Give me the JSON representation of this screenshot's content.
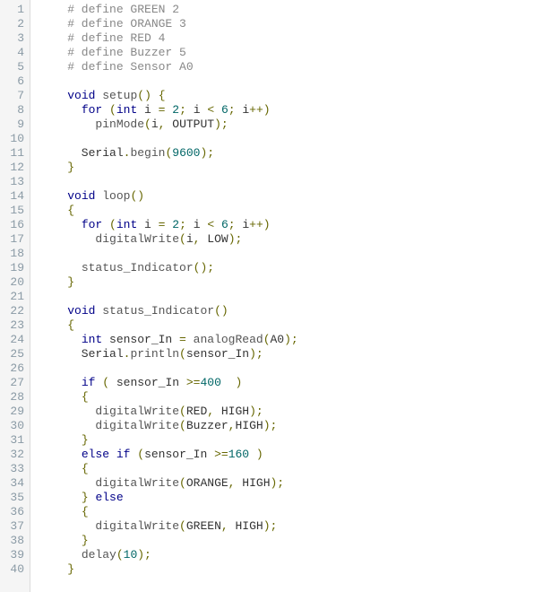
{
  "editor": {
    "lines": [
      {
        "n": 1,
        "tokens": [
          [
            "pp",
            "    # define GREEN 2"
          ]
        ]
      },
      {
        "n": 2,
        "tokens": [
          [
            "pp",
            "    # define ORANGE 3"
          ]
        ]
      },
      {
        "n": 3,
        "tokens": [
          [
            "pp",
            "    # define RED 4"
          ]
        ]
      },
      {
        "n": 4,
        "tokens": [
          [
            "pp",
            "    # define Buzzer 5"
          ]
        ]
      },
      {
        "n": 5,
        "tokens": [
          [
            "pp",
            "    # define Sensor A0"
          ]
        ]
      },
      {
        "n": 6,
        "tokens": [
          [
            "id",
            ""
          ]
        ]
      },
      {
        "n": 7,
        "tokens": [
          [
            "id",
            "    "
          ],
          [
            "kw",
            "void"
          ],
          [
            "id",
            " "
          ],
          [
            "fn",
            "setup"
          ],
          [
            "op",
            "()"
          ],
          [
            "id",
            " "
          ],
          [
            "op",
            "{"
          ]
        ]
      },
      {
        "n": 8,
        "tokens": [
          [
            "id",
            "      "
          ],
          [
            "kw",
            "for"
          ],
          [
            "id",
            " "
          ],
          [
            "op",
            "("
          ],
          [
            "kw",
            "int"
          ],
          [
            "id",
            " i "
          ],
          [
            "op",
            "="
          ],
          [
            "id",
            " "
          ],
          [
            "num",
            "2"
          ],
          [
            "op",
            ";"
          ],
          [
            "id",
            " i "
          ],
          [
            "op",
            "<"
          ],
          [
            "id",
            " "
          ],
          [
            "num",
            "6"
          ],
          [
            "op",
            ";"
          ],
          [
            "id",
            " i"
          ],
          [
            "op",
            "++)"
          ]
        ]
      },
      {
        "n": 9,
        "tokens": [
          [
            "id",
            "        "
          ],
          [
            "fn",
            "pinMode"
          ],
          [
            "op",
            "("
          ],
          [
            "id",
            "i"
          ],
          [
            "op",
            ","
          ],
          [
            "id",
            " OUTPUT"
          ],
          [
            "op",
            ");"
          ]
        ]
      },
      {
        "n": 10,
        "tokens": [
          [
            "id",
            ""
          ]
        ]
      },
      {
        "n": 11,
        "tokens": [
          [
            "id",
            "      Serial"
          ],
          [
            "op",
            "."
          ],
          [
            "fn",
            "begin"
          ],
          [
            "op",
            "("
          ],
          [
            "num",
            "9600"
          ],
          [
            "op",
            ");"
          ]
        ]
      },
      {
        "n": 12,
        "tokens": [
          [
            "id",
            "    "
          ],
          [
            "op",
            "}"
          ]
        ]
      },
      {
        "n": 13,
        "tokens": [
          [
            "id",
            ""
          ]
        ]
      },
      {
        "n": 14,
        "tokens": [
          [
            "id",
            "    "
          ],
          [
            "kw",
            "void"
          ],
          [
            "id",
            " "
          ],
          [
            "fn",
            "loop"
          ],
          [
            "op",
            "()"
          ]
        ]
      },
      {
        "n": 15,
        "tokens": [
          [
            "id",
            "    "
          ],
          [
            "op",
            "{"
          ]
        ]
      },
      {
        "n": 16,
        "tokens": [
          [
            "id",
            "      "
          ],
          [
            "kw",
            "for"
          ],
          [
            "id",
            " "
          ],
          [
            "op",
            "("
          ],
          [
            "kw",
            "int"
          ],
          [
            "id",
            " i "
          ],
          [
            "op",
            "="
          ],
          [
            "id",
            " "
          ],
          [
            "num",
            "2"
          ],
          [
            "op",
            ";"
          ],
          [
            "id",
            " i "
          ],
          [
            "op",
            "<"
          ],
          [
            "id",
            " "
          ],
          [
            "num",
            "6"
          ],
          [
            "op",
            ";"
          ],
          [
            "id",
            " i"
          ],
          [
            "op",
            "++)"
          ]
        ]
      },
      {
        "n": 17,
        "tokens": [
          [
            "id",
            "        "
          ],
          [
            "fn",
            "digitalWrite"
          ],
          [
            "op",
            "("
          ],
          [
            "id",
            "i"
          ],
          [
            "op",
            ","
          ],
          [
            "id",
            " LOW"
          ],
          [
            "op",
            ");"
          ]
        ]
      },
      {
        "n": 18,
        "tokens": [
          [
            "id",
            ""
          ]
        ]
      },
      {
        "n": 19,
        "tokens": [
          [
            "id",
            "      "
          ],
          [
            "fn",
            "status_Indicator"
          ],
          [
            "op",
            "();"
          ]
        ]
      },
      {
        "n": 20,
        "tokens": [
          [
            "id",
            "    "
          ],
          [
            "op",
            "}"
          ]
        ]
      },
      {
        "n": 21,
        "tokens": [
          [
            "id",
            ""
          ]
        ]
      },
      {
        "n": 22,
        "tokens": [
          [
            "id",
            "    "
          ],
          [
            "kw",
            "void"
          ],
          [
            "id",
            " "
          ],
          [
            "fn",
            "status_Indicator"
          ],
          [
            "op",
            "()"
          ]
        ]
      },
      {
        "n": 23,
        "tokens": [
          [
            "id",
            "    "
          ],
          [
            "op",
            "{"
          ]
        ]
      },
      {
        "n": 24,
        "tokens": [
          [
            "id",
            "      "
          ],
          [
            "kw",
            "int"
          ],
          [
            "id",
            " sensor_In "
          ],
          [
            "op",
            "="
          ],
          [
            "id",
            " "
          ],
          [
            "fn",
            "analogRead"
          ],
          [
            "op",
            "("
          ],
          [
            "id",
            "A0"
          ],
          [
            "op",
            ");"
          ]
        ]
      },
      {
        "n": 25,
        "tokens": [
          [
            "id",
            "      Serial"
          ],
          [
            "op",
            "."
          ],
          [
            "fn",
            "println"
          ],
          [
            "op",
            "("
          ],
          [
            "id",
            "sensor_In"
          ],
          [
            "op",
            ");"
          ]
        ]
      },
      {
        "n": 26,
        "tokens": [
          [
            "id",
            ""
          ]
        ]
      },
      {
        "n": 27,
        "tokens": [
          [
            "id",
            "      "
          ],
          [
            "kw",
            "if"
          ],
          [
            "id",
            " "
          ],
          [
            "op",
            "("
          ],
          [
            "id",
            " sensor_In "
          ],
          [
            "op",
            ">="
          ],
          [
            "num",
            "400"
          ],
          [
            "id",
            "  "
          ],
          [
            "op",
            ")"
          ]
        ]
      },
      {
        "n": 28,
        "tokens": [
          [
            "id",
            "      "
          ],
          [
            "op",
            "{"
          ]
        ]
      },
      {
        "n": 29,
        "tokens": [
          [
            "id",
            "        "
          ],
          [
            "fn",
            "digitalWrite"
          ],
          [
            "op",
            "("
          ],
          [
            "id",
            "RED"
          ],
          [
            "op",
            ","
          ],
          [
            "id",
            " HIGH"
          ],
          [
            "op",
            ");"
          ]
        ]
      },
      {
        "n": 30,
        "tokens": [
          [
            "id",
            "        "
          ],
          [
            "fn",
            "digitalWrite"
          ],
          [
            "op",
            "("
          ],
          [
            "id",
            "Buzzer"
          ],
          [
            "op",
            ","
          ],
          [
            "id",
            "HIGH"
          ],
          [
            "op",
            ");"
          ]
        ]
      },
      {
        "n": 31,
        "tokens": [
          [
            "id",
            "      "
          ],
          [
            "op",
            "}"
          ]
        ]
      },
      {
        "n": 32,
        "tokens": [
          [
            "id",
            "      "
          ],
          [
            "kw",
            "else"
          ],
          [
            "id",
            " "
          ],
          [
            "kw",
            "if"
          ],
          [
            "id",
            " "
          ],
          [
            "op",
            "("
          ],
          [
            "id",
            "sensor_In "
          ],
          [
            "op",
            ">="
          ],
          [
            "num",
            "160"
          ],
          [
            "id",
            " "
          ],
          [
            "op",
            ")"
          ]
        ]
      },
      {
        "n": 33,
        "tokens": [
          [
            "id",
            "      "
          ],
          [
            "op",
            "{"
          ]
        ]
      },
      {
        "n": 34,
        "tokens": [
          [
            "id",
            "        "
          ],
          [
            "fn",
            "digitalWrite"
          ],
          [
            "op",
            "("
          ],
          [
            "id",
            "ORANGE"
          ],
          [
            "op",
            ","
          ],
          [
            "id",
            " HIGH"
          ],
          [
            "op",
            ");"
          ]
        ]
      },
      {
        "n": 35,
        "tokens": [
          [
            "id",
            "      "
          ],
          [
            "op",
            "}"
          ],
          [
            "id",
            " "
          ],
          [
            "kw",
            "else"
          ]
        ]
      },
      {
        "n": 36,
        "tokens": [
          [
            "id",
            "      "
          ],
          [
            "op",
            "{"
          ]
        ]
      },
      {
        "n": 37,
        "tokens": [
          [
            "id",
            "        "
          ],
          [
            "fn",
            "digitalWrite"
          ],
          [
            "op",
            "("
          ],
          [
            "id",
            "GREEN"
          ],
          [
            "op",
            ","
          ],
          [
            "id",
            " HIGH"
          ],
          [
            "op",
            ");"
          ]
        ]
      },
      {
        "n": 38,
        "tokens": [
          [
            "id",
            "      "
          ],
          [
            "op",
            "}"
          ]
        ]
      },
      {
        "n": 39,
        "tokens": [
          [
            "id",
            "      "
          ],
          [
            "fn",
            "delay"
          ],
          [
            "op",
            "("
          ],
          [
            "num",
            "10"
          ],
          [
            "op",
            ");"
          ]
        ]
      },
      {
        "n": 40,
        "tokens": [
          [
            "id",
            "    "
          ],
          [
            "op",
            "}"
          ]
        ]
      }
    ]
  }
}
